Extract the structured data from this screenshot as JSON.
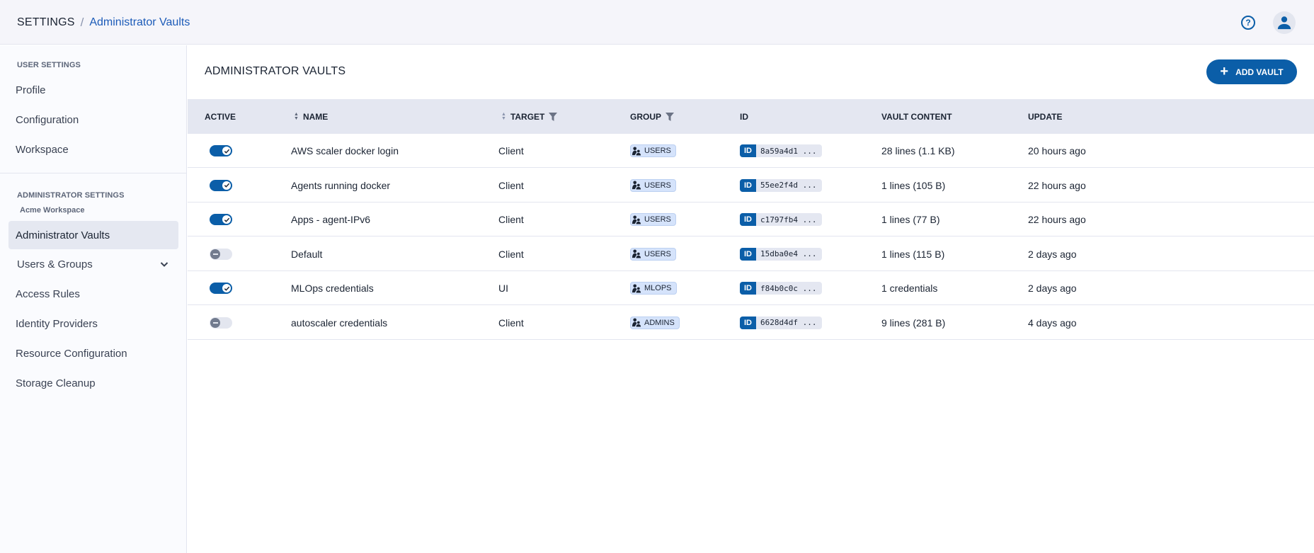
{
  "header": {
    "breadcrumb_root": "SETTINGS",
    "breadcrumb_sep": "/",
    "breadcrumb_current": "Administrator Vaults",
    "help_icon": "question-circle-icon",
    "avatar_icon": "user-icon"
  },
  "sidebar": {
    "user_section_title": "USER SETTINGS",
    "user_items": [
      {
        "label": "Profile"
      },
      {
        "label": "Configuration"
      },
      {
        "label": "Workspace"
      }
    ],
    "admin_section_title": "ADMINISTRATOR SETTINGS",
    "admin_section_subtitle": "Acme Workspace",
    "admin_items": [
      {
        "label": "Administrator Vaults",
        "active": true
      },
      {
        "label": "Users & Groups",
        "expandable": true
      },
      {
        "label": "Access Rules"
      },
      {
        "label": "Identity Providers"
      },
      {
        "label": "Resource Configuration"
      },
      {
        "label": "Storage Cleanup"
      }
    ]
  },
  "main": {
    "title": "ADMINISTRATOR VAULTS",
    "add_button_label": "ADD VAULT",
    "columns": {
      "active": "ACTIVE",
      "name": "NAME",
      "target": "TARGET",
      "group": "GROUP",
      "id": "ID",
      "content": "VAULT CONTENT",
      "update": "UPDATE"
    },
    "id_tag": "ID",
    "rows": [
      {
        "active": true,
        "name": "AWS scaler docker login",
        "target": "Client",
        "group": "USERS",
        "id": "8a59a4d1 ...",
        "content": "28 lines (1.1 KB)",
        "update": "20 hours ago"
      },
      {
        "active": true,
        "name": "Agents running docker",
        "target": "Client",
        "group": "USERS",
        "id": "55ee2f4d ...",
        "content": "1 lines (105 B)",
        "update": "22 hours ago"
      },
      {
        "active": true,
        "name": "Apps - agent-IPv6",
        "target": "Client",
        "group": "USERS",
        "id": "c1797fb4 ...",
        "content": "1 lines (77 B)",
        "update": "22 hours ago"
      },
      {
        "active": false,
        "name": "Default",
        "target": "Client",
        "group": "USERS",
        "id": "15dba0e4 ...",
        "content": "1 lines (115 B)",
        "update": "2 days ago"
      },
      {
        "active": true,
        "name": "MLOps credentials",
        "target": "UI",
        "group": "MLOPS",
        "id": "f84b0c0c ...",
        "content": "1 credentials",
        "update": "2 days ago"
      },
      {
        "active": false,
        "name": "autoscaler credentials",
        "target": "Client",
        "group": "ADMINS",
        "id": "6628d4df ...",
        "content": "9 lines (281 B)",
        "update": "4 days ago"
      }
    ]
  },
  "colors": {
    "accent": "#0b5ea8",
    "breadcrumb_link": "#1c5bb8",
    "table_header_bg": "#e4e7f1",
    "group_chip_bg": "#d5e3fb"
  }
}
